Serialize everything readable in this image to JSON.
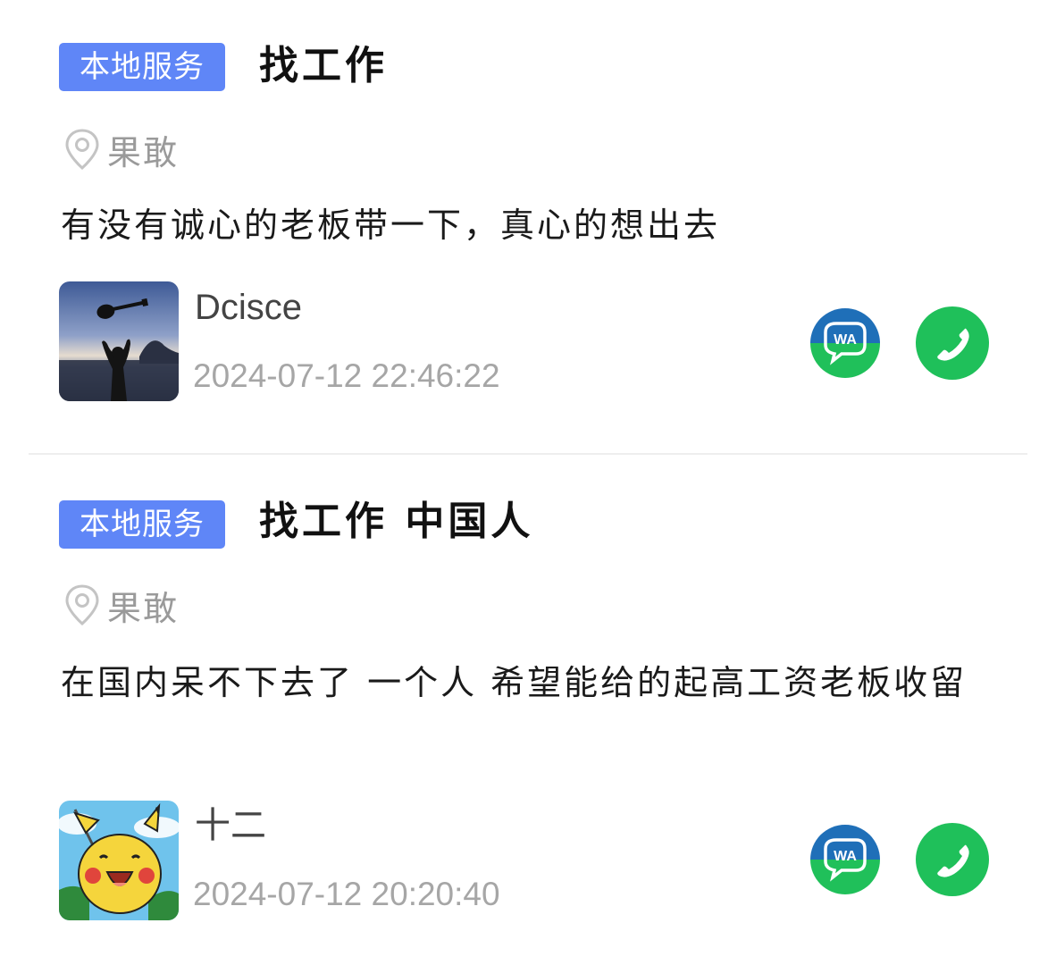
{
  "posts": [
    {
      "tag": "本地服务",
      "title": "找工作",
      "location": "果敢",
      "description": "有没有诚心的老板带一下，真心的想出去",
      "user": {
        "name": "Dcisce",
        "avatar": "avatar-guitar-beach"
      },
      "time": "2024-07-12 22:46:22",
      "actions": {
        "whatsapp_icon": "whatsapp-icon",
        "phone_icon": "phone-icon"
      }
    },
    {
      "tag": "本地服务",
      "title": "找工作 中国人",
      "location": "果敢",
      "description": "在国内呆不下去了 一个人 希望能给的起高工资老板收留",
      "user": {
        "name": "十二",
        "avatar": "avatar-pikachu"
      },
      "time": "2024-07-12 20:20:40",
      "actions": {
        "whatsapp_icon": "whatsapp-icon",
        "phone_icon": "phone-icon"
      }
    }
  ],
  "colors": {
    "tag_bg": "#5f86f7",
    "whatsapp_blue": "#1f6fb8",
    "whatsapp_green": "#20c05a",
    "phone_green": "#1fc05a",
    "muted_text": "#9a9a9a"
  }
}
